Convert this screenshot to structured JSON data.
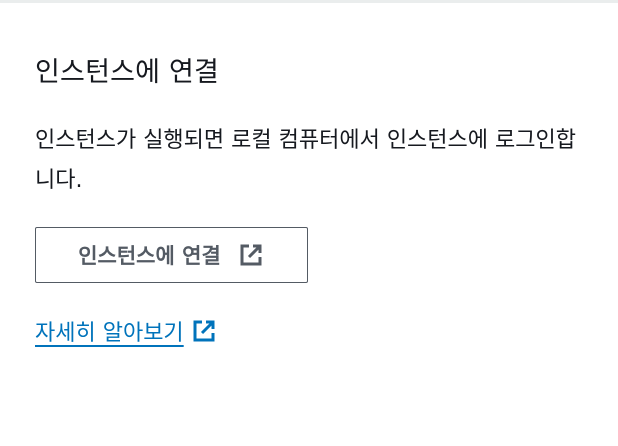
{
  "panel": {
    "title": "인스턴스에 연결",
    "description": "인스턴스가 실행되면 로컬 컴퓨터에서 인스턴스에 로그인합니다.",
    "connect_button_label": "인스턴스에 연결",
    "learn_more_label": "자세히 알아보기"
  },
  "colors": {
    "text": "#16191f",
    "button_text": "#545b64",
    "link": "#0073bb",
    "border": "#545b64"
  },
  "icons": {
    "connect_button_icon": "external-link-icon",
    "learn_more_icon": "external-link-icon"
  }
}
